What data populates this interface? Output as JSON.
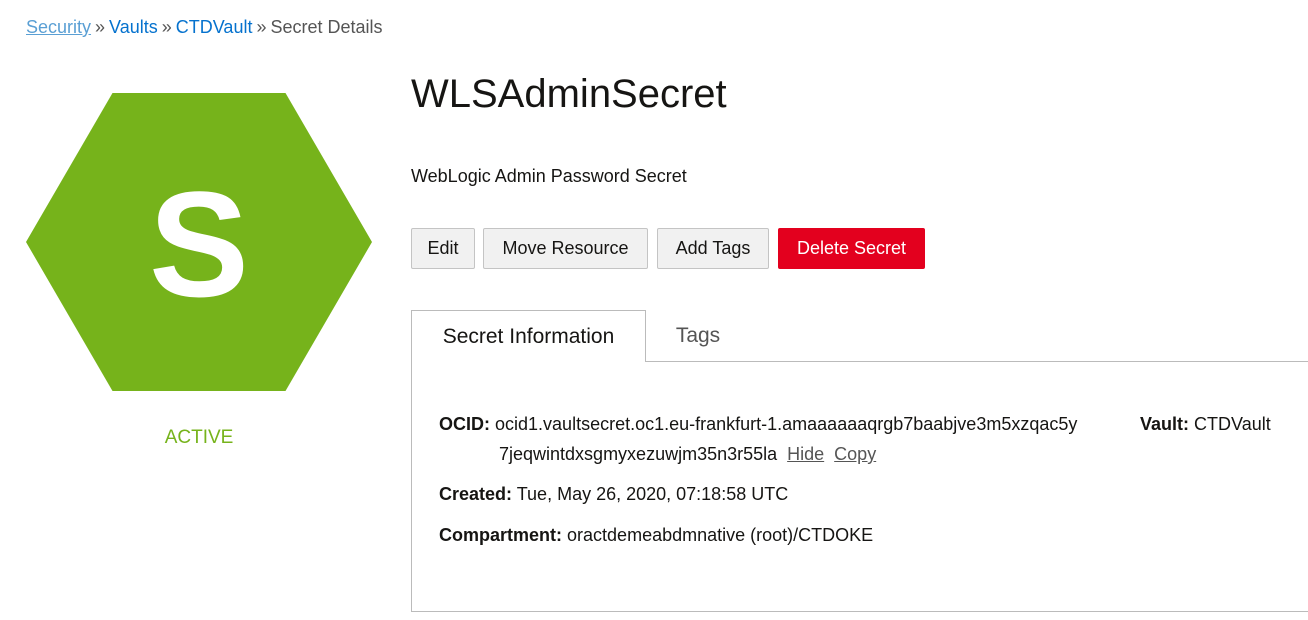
{
  "breadcrumb": {
    "items": [
      "Security",
      "Vaults",
      "CTDVault"
    ],
    "separator": "»",
    "current": "Secret Details"
  },
  "resource": {
    "icon_letter": "S",
    "icon_color": "#76b31b",
    "status": "ACTIVE",
    "status_color": "#76b31b",
    "name": "WLSAdminSecret",
    "description": "WebLogic Admin Password Secret"
  },
  "actions": {
    "edit": "Edit",
    "move": "Move Resource",
    "add_tags": "Add Tags",
    "delete": "Delete Secret"
  },
  "tabs": [
    {
      "label": "Secret Information",
      "active": true
    },
    {
      "label": "Tags",
      "active": false
    }
  ],
  "info": {
    "ocid_label": "OCID:",
    "ocid_line1": "ocid1.vaultsecret.oc1.eu-frankfurt-1.amaaaaaaqrgb7baabjve3m5xzqac5y",
    "ocid_line2": "7jeqwintdxsgmyxezuwjm35n3r55la",
    "hide": "Hide",
    "copy": "Copy",
    "vault_label": "Vault:",
    "vault_value": "CTDVault",
    "created_label": "Created:",
    "created_value": "Tue, May 26, 2020, 07:18:58 UTC",
    "compartment_label": "Compartment:",
    "compartment_value": "oractdemeabdmnative (root)/CTDOKE"
  }
}
